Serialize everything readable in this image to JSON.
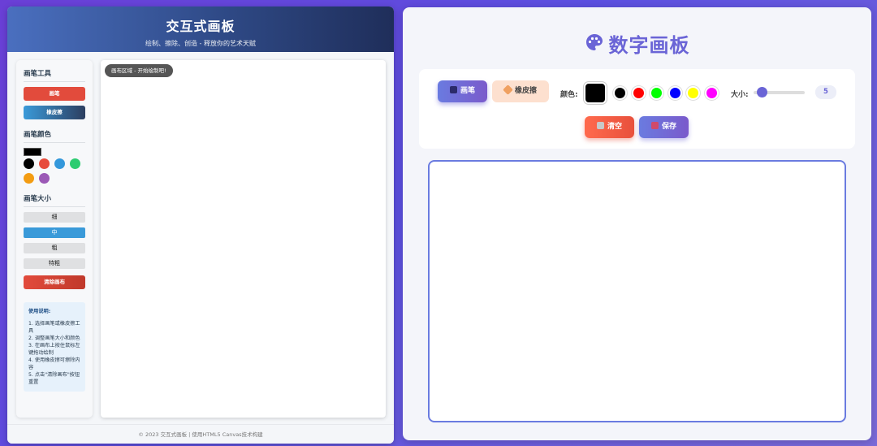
{
  "left": {
    "header": {
      "title": "交互式画板",
      "subtitle": "绘制、擦除、创造 - 释放你的艺术天赋"
    },
    "sidebar": {
      "tools_heading": "画笔工具",
      "brush_label": "画笔",
      "eraser_label": "橡皮擦",
      "colors_heading": "画笔颜色",
      "colors": [
        "#000000",
        "#e74c3c",
        "#3498db",
        "#2ecc71",
        "#f39c12",
        "#9b59b6"
      ],
      "size_heading": "画笔大小",
      "sizes": [
        "细",
        "中",
        "粗",
        "特粗"
      ],
      "active_size": "中",
      "clear_label": "清除画布",
      "help": {
        "title": "使用说明:",
        "steps": [
          "1. 选择画笔或橡皮擦工具",
          "2. 调整画笔大小和颜色",
          "3. 在画布上按住鼠标左键拖动绘制",
          "4. 使用橡皮擦可擦除内容",
          "5. 点击\"清除画布\"按钮重置"
        ]
      }
    },
    "canvas_tag": "画布区域 - 开始绘制吧!",
    "footer": "© 2023 交互式画板 | 使用HTML5 Canvas技术构建"
  },
  "right": {
    "title": "数字画板",
    "toolbar": {
      "brush_label": "画笔",
      "eraser_label": "橡皮擦",
      "color_label": "颜色:",
      "current_color": "#000000",
      "colors": [
        "#000000",
        "#ff0000",
        "#00ff00",
        "#0000ff",
        "#ffff00",
        "#ff00ff"
      ],
      "size_label": "大小:",
      "size_value": "5",
      "clear_label": "清空",
      "save_label": "保存"
    }
  }
}
